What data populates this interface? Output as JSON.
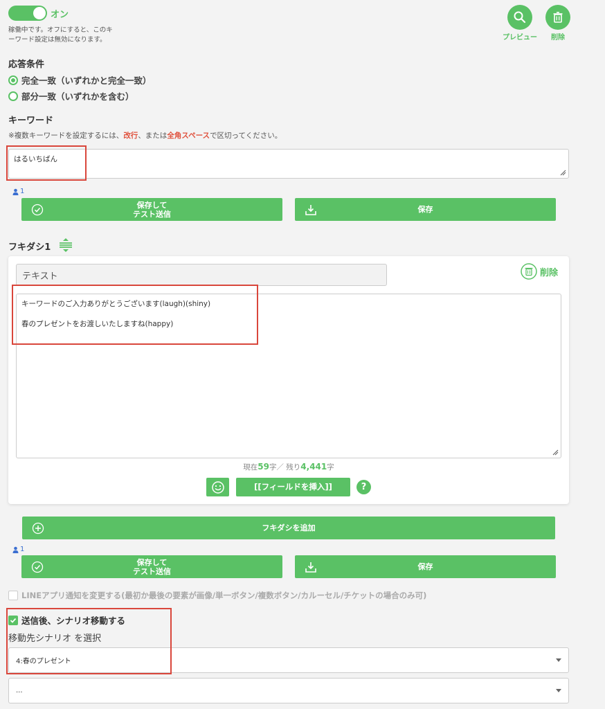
{
  "status": {
    "toggle_label": "オン",
    "help_line1": "稼働中です。オフにすると、このキ",
    "help_line2": "ーワード設定は無効になります。"
  },
  "actions": {
    "preview_label": "プレビュー",
    "delete_label": "削除"
  },
  "response_condition": {
    "title": "応答条件",
    "options": [
      {
        "label": "完全一致（いずれかと完全一致）",
        "selected": true
      },
      {
        "label": "部分一致（いずれかを含む）",
        "selected": false
      }
    ]
  },
  "keyword": {
    "title": "キーワード",
    "note_prefix": "※複数キーワードを設定するには、",
    "note_red1": "改行",
    "note_mid": "、または",
    "note_red2": "全角スペース",
    "note_suffix": "で区切ってください。",
    "value": "はるいちばん",
    "count": "1"
  },
  "buttons": {
    "save_test_line1": "保存して",
    "save_test_line2": "テスト送信",
    "save": "保存",
    "add_bubble": "フキダシを追加",
    "insert_field": "[[フィールドを挿入]]",
    "help": "?"
  },
  "bubble": {
    "title": "フキダシ1",
    "type": "テキスト",
    "delete_label": "削除",
    "line1": "キーワードのご入力ありがとうございます(laugh)(shiny)",
    "line2": "春のプレゼントをお渡しいたしますね(happy)",
    "counter_prefix": "現在",
    "counter_current": "59",
    "counter_mid": "字／ 残り",
    "counter_remaining": "4,441",
    "counter_suffix": "字"
  },
  "bottom": {
    "count": "1",
    "line_notify_label": "LINEアプリ通知を変更する(最初か最後の要素が画像/単一ボタン/複数ボタン/カルーセル/チケットの場合のみ可)",
    "scenario_move_label": "送信後、シナリオ移動する",
    "scenario_select_title": "移動先シナリオ を選択",
    "scenario_selected": "4:春のプレゼント",
    "second_select": "..."
  },
  "colors": {
    "accent": "#5ac165",
    "highlight": "#d9463b",
    "link_blue": "#3b6fd1"
  }
}
